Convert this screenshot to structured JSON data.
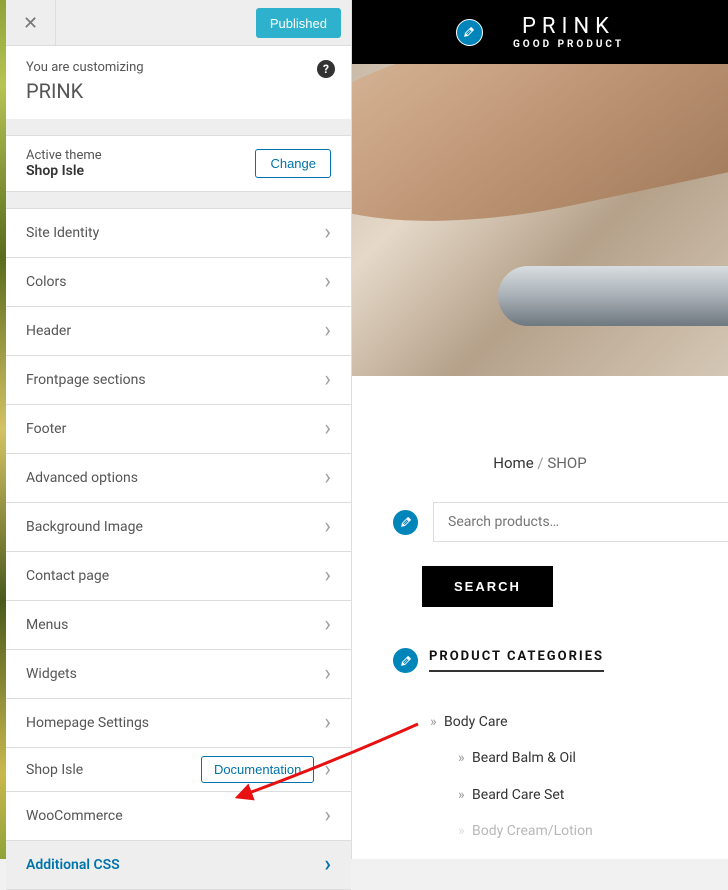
{
  "topBar": {
    "publishLabel": "Published"
  },
  "customizing": {
    "label": "You are customizing",
    "siteTitle": "PRINK"
  },
  "theme": {
    "label": "Active theme",
    "name": "Shop Isle",
    "changeLabel": "Change"
  },
  "menu": [
    {
      "label": "Site Identity"
    },
    {
      "label": "Colors"
    },
    {
      "label": "Header"
    },
    {
      "label": "Frontpage sections"
    },
    {
      "label": "Footer"
    },
    {
      "label": "Advanced options"
    },
    {
      "label": "Background Image"
    },
    {
      "label": "Contact page"
    },
    {
      "label": "Menus"
    },
    {
      "label": "Widgets"
    },
    {
      "label": "Homepage Settings"
    },
    {
      "label": "Shop Isle",
      "button": "Documentation"
    },
    {
      "label": "WooCommerce"
    },
    {
      "label": "Additional CSS",
      "active": true
    }
  ],
  "preview": {
    "logoTitle": "PRINK",
    "logoSubtitle": "GOOD PRODUCT",
    "breadcrumb": {
      "home": "Home",
      "sep": " / ",
      "current": "SHOP"
    },
    "searchPlaceholder": "Search products…",
    "searchButton": "SEARCH",
    "categoriesTitle": "PRODUCT CATEGORIES",
    "categories": [
      {
        "label": "Body Care",
        "children": [
          {
            "label": "Beard Balm & Oil"
          },
          {
            "label": "Beard Care Set"
          },
          {
            "label": "Body Cream/Lotion"
          }
        ]
      }
    ]
  }
}
